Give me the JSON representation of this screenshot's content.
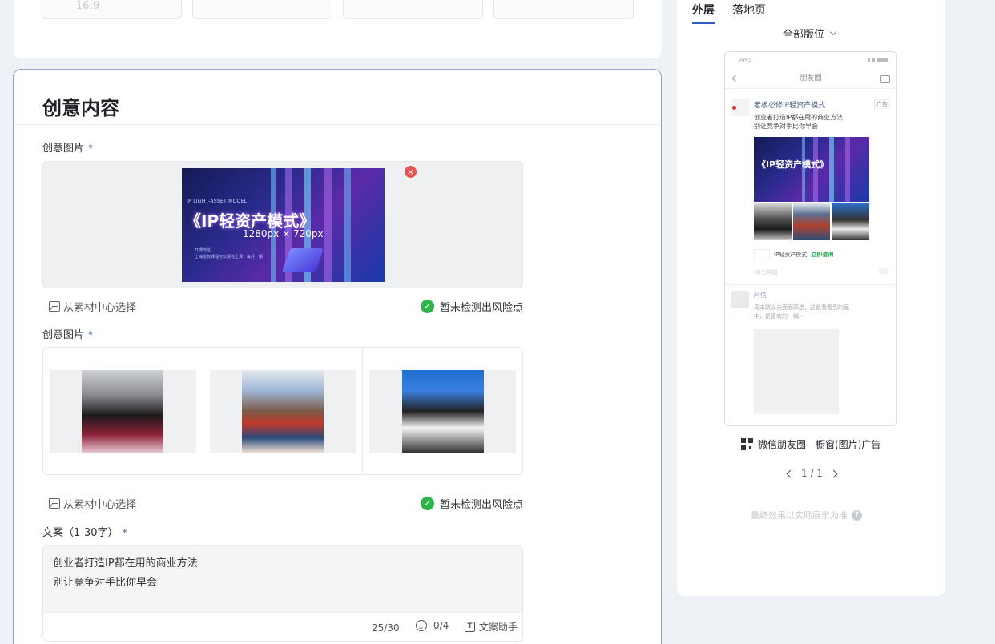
{
  "top_card": {
    "ratio_options": [
      "16:9",
      "",
      "",
      ""
    ]
  },
  "creative": {
    "title": "创意内容",
    "image_label_1": "创意图片",
    "image_label_2": "创意图片",
    "required_mark": "*",
    "banner": {
      "small_text": "IP LIGHT-ASSET MODEL",
      "big_text": "《IP轻资产模式》",
      "size_text": "1280px × 720px",
      "line1": "开课地址:",
      "line2": "上海授权课程可以报名上课，每月一期"
    },
    "pick_material": "从素材中心选择",
    "risk_ok": "暂未检测出风险点",
    "copy_label": "文案（1-30字）",
    "copy_text": "创业者打造IP都在用的商业方法\n别让竞争对手比你早会",
    "char_count": "25/30",
    "emoji_count": "0/4",
    "copy_helper": "文案助手"
  },
  "preview": {
    "tabs": [
      "外层",
      "落地页"
    ],
    "position_select": "全部版位",
    "phone": {
      "status": "AMS",
      "nav_title": "朋友圈",
      "ad_name": "老板必修IP轻资产模式",
      "ad_badge": "广告",
      "ad_text": "创业者打造IP都在用的商业方法\n别让竞争对手比你早会",
      "banner_title": "《IP轻资产模式》",
      "link_name": "IP轻资产模式",
      "cta": "立即咨询",
      "time": "30分钟前",
      "friend_name": "阿信",
      "friend_text": "周末跳没去面面四选，这是我看到的画\n中，是喜欢的一幅～"
    },
    "caption": "微信朋友圈 - 橱窗(图片)广告",
    "pager": "1 / 1",
    "note": "最终效果以实际展示为准"
  }
}
